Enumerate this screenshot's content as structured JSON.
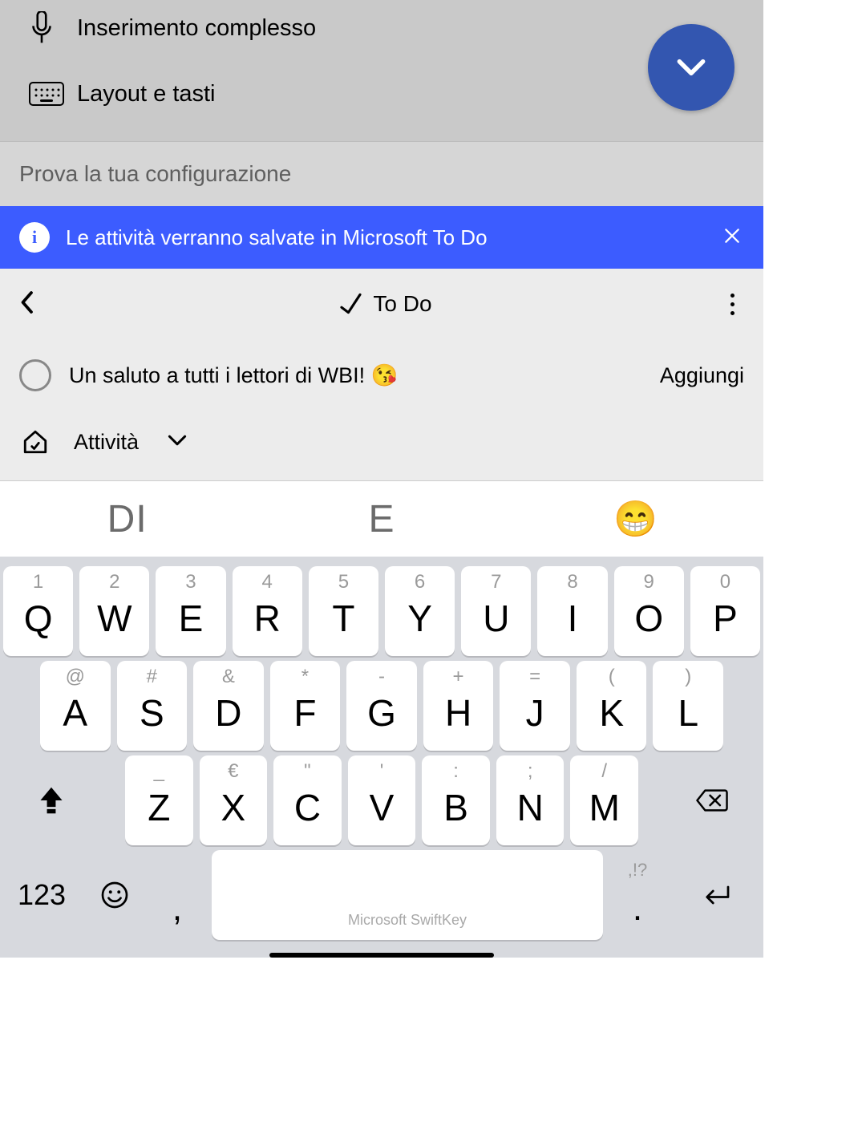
{
  "settings": {
    "items": [
      {
        "label": "Inserimento complesso",
        "icon": "mic-icon"
      },
      {
        "label": "Layout e tasti",
        "icon": "keyboard-icon"
      }
    ],
    "config_test_label": "Prova la tua configurazione"
  },
  "banner": {
    "info_glyph": "i",
    "message": "Le attività verranno salvate in Microsoft To Do"
  },
  "todo": {
    "title": "To Do",
    "task_text": "Un saluto a tutti i lettori di WBI! 😘",
    "add_label": "Aggiungi",
    "list_label": "Attività"
  },
  "keyboard": {
    "suggestions": [
      "DI",
      "E",
      "😁"
    ],
    "row1": [
      {
        "hint": "1",
        "main": "Q"
      },
      {
        "hint": "2",
        "main": "W"
      },
      {
        "hint": "3",
        "main": "E"
      },
      {
        "hint": "4",
        "main": "R"
      },
      {
        "hint": "5",
        "main": "T"
      },
      {
        "hint": "6",
        "main": "Y"
      },
      {
        "hint": "7",
        "main": "U"
      },
      {
        "hint": "8",
        "main": "I"
      },
      {
        "hint": "9",
        "main": "O"
      },
      {
        "hint": "0",
        "main": "P"
      }
    ],
    "row2": [
      {
        "hint": "@",
        "main": "A"
      },
      {
        "hint": "#",
        "main": "S"
      },
      {
        "hint": "&",
        "main": "D"
      },
      {
        "hint": "*",
        "main": "F"
      },
      {
        "hint": "-",
        "main": "G"
      },
      {
        "hint": "+",
        "main": "H"
      },
      {
        "hint": "=",
        "main": "J"
      },
      {
        "hint": "(",
        "main": "K"
      },
      {
        "hint": ")",
        "main": "L"
      }
    ],
    "row3": [
      {
        "hint": "_",
        "main": "Z"
      },
      {
        "hint": "€",
        "main": "X"
      },
      {
        "hint": "\"",
        "main": "C"
      },
      {
        "hint": "'",
        "main": "V"
      },
      {
        "hint": ":",
        "main": "B"
      },
      {
        "hint": ";",
        "main": "N"
      },
      {
        "hint": "/",
        "main": "M"
      }
    ],
    "numbers_label": "123",
    "comma": ",",
    "period": ".",
    "period_hint": ",!?",
    "space_label": "Microsoft SwiftKey"
  }
}
